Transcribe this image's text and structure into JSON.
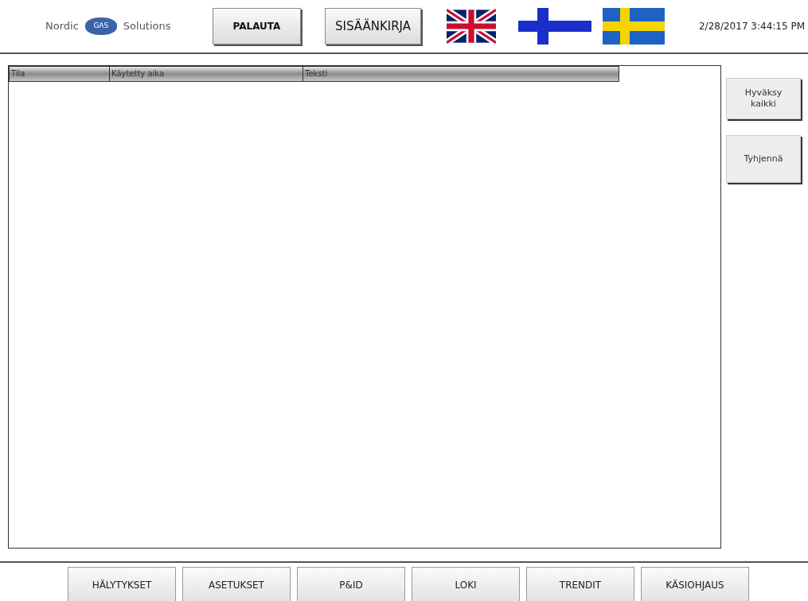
{
  "header": {
    "logo": {
      "left": "Nordic",
      "badge": "GAS",
      "right": "Solutions"
    },
    "buttons": [
      {
        "label": "PALAUTA",
        "kind": "bold"
      },
      {
        "label": "SISÄÄNKIRJA",
        "kind": "plain"
      }
    ],
    "datetime": "2/28/2017 3:44:15 PM"
  },
  "table": {
    "columns": [
      {
        "label": "Tila"
      },
      {
        "label": "Käytetty aika"
      },
      {
        "label": "Teksti"
      }
    ]
  },
  "side_buttons": [
    "Hyväksy kaikki",
    "Tyhjennä"
  ],
  "nav_buttons": [
    "HÄLYTYKSET",
    "ASETUKSET",
    "P&ID",
    "LOKI",
    "TRENDIT",
    "KÄSIOHJAUS"
  ]
}
